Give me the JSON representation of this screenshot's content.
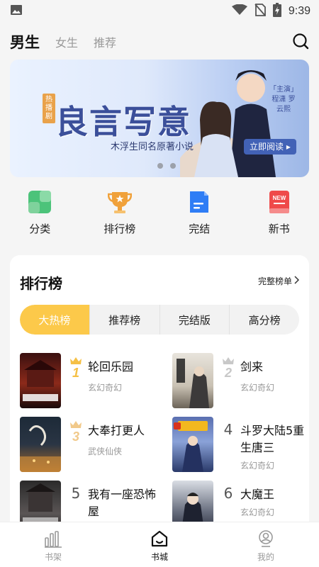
{
  "status_bar": {
    "time": "9:39",
    "icons": [
      "image-icon",
      "wifi-icon",
      "no-sim-icon",
      "battery-charging-icon"
    ]
  },
  "top_nav": {
    "tabs": [
      {
        "label": "男生",
        "active": true
      },
      {
        "label": "女生",
        "active": false
      },
      {
        "label": "推荐",
        "active": false
      }
    ],
    "search_icon": "search-icon"
  },
  "banner": {
    "tag": "热播剧",
    "title": "良言写意",
    "subtitle": "木浮生同名原著小说",
    "cast": "「主演」程潇 罗云熙",
    "read_button": "立即阅读 ▸",
    "dots": 2
  },
  "categories": [
    {
      "label": "分类",
      "icon": "grid-icon",
      "color": "#4cc37a"
    },
    {
      "label": "排行榜",
      "icon": "trophy-icon",
      "color": "#f0a13a"
    },
    {
      "label": "完结",
      "icon": "document-icon",
      "color": "#2f7df5"
    },
    {
      "label": "新书",
      "icon": "new-book-icon",
      "color": "#ef4a4a"
    }
  ],
  "ranking": {
    "title": "排行榜",
    "more_label": "完整榜单",
    "tabs": [
      {
        "label": "大热榜",
        "active": true
      },
      {
        "label": "推荐榜",
        "active": false
      },
      {
        "label": "完结版",
        "active": false
      },
      {
        "label": "高分榜",
        "active": false
      }
    ],
    "books": [
      {
        "rank": "1",
        "title": "轮回乐园",
        "genre": "玄幻奇幻",
        "crown": "gold"
      },
      {
        "rank": "2",
        "title": "剑来",
        "genre": "玄幻奇幻",
        "crown": "silver"
      },
      {
        "rank": "3",
        "title": "大奉打更人",
        "genre": "武侠仙侠",
        "crown": "bronze"
      },
      {
        "rank": "4",
        "title": "斗罗大陆5重生唐三",
        "genre": "玄幻奇幻",
        "crown": ""
      },
      {
        "rank": "5",
        "title": "我有一座恐怖屋",
        "genre": "",
        "crown": ""
      },
      {
        "rank": "6",
        "title": "大魔王",
        "genre": "玄幻奇幻",
        "crown": ""
      }
    ]
  },
  "bottom_nav": [
    {
      "label": "书架",
      "icon": "bookshelf-icon",
      "active": false
    },
    {
      "label": "书城",
      "icon": "home-icon",
      "active": true
    },
    {
      "label": "我的",
      "icon": "profile-icon",
      "active": false
    }
  ],
  "colors": {
    "accent": "#fcc94a",
    "background": "#f5f5f5",
    "banner_text": "#3b4f9a"
  }
}
